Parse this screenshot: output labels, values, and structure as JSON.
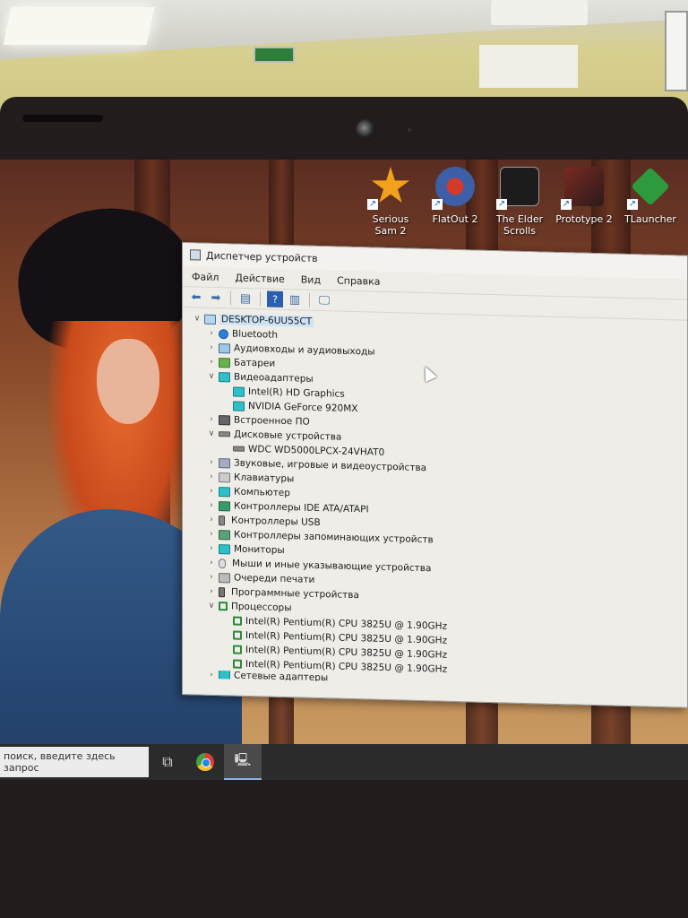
{
  "desktop": {
    "icons": [
      {
        "label": "Serious Sam 2",
        "color": "#f2a21a"
      },
      {
        "label": "FlatOut 2",
        "color": "#3c5fa8"
      },
      {
        "label": "The Elder Scrolls",
        "color": "#1c1c1c"
      },
      {
        "label": "Prototype 2",
        "color": "#7a2a22"
      },
      {
        "label": "TLauncher",
        "color": "#2e9a3e"
      }
    ]
  },
  "window": {
    "title": "Диспетчер устройств",
    "menu": [
      "Файл",
      "Действие",
      "Вид",
      "Справка"
    ],
    "toolbar": [
      "back-icon",
      "forward-icon",
      "properties-icon",
      "help-icon",
      "view-icon",
      "monitor-icon"
    ],
    "tree": {
      "root": "DESKTOP-6UU55CT",
      "items": [
        {
          "label": "Bluetooth",
          "expanded": false,
          "icon": "bluetooth-icon"
        },
        {
          "label": "Аудиовходы и аудиовыходы",
          "expanded": false,
          "icon": "audio-icon"
        },
        {
          "label": "Батареи",
          "expanded": false,
          "icon": "battery-icon"
        },
        {
          "label": "Видеоадаптеры",
          "expanded": true,
          "icon": "display-adapter-icon",
          "children": [
            "Intel(R) HD Graphics",
            "NVIDIA GeForce 920MX"
          ]
        },
        {
          "label": "Встроенное ПО",
          "expanded": false,
          "icon": "firmware-icon"
        },
        {
          "label": "Дисковые устройства",
          "expanded": true,
          "icon": "disk-icon",
          "children": [
            "WDC WD5000LPCX-24VHAT0"
          ]
        },
        {
          "label": "Звуковые, игровые и видеоустройства",
          "expanded": false,
          "icon": "sound-icon"
        },
        {
          "label": "Клавиатуры",
          "expanded": false,
          "icon": "keyboard-icon"
        },
        {
          "label": "Компьютер",
          "expanded": false,
          "icon": "computer-icon"
        },
        {
          "label": "Контроллеры IDE ATA/ATAPI",
          "expanded": false,
          "icon": "ide-icon"
        },
        {
          "label": "Контроллеры USB",
          "expanded": false,
          "icon": "usb-icon"
        },
        {
          "label": "Контроллеры запоминающих устройств",
          "expanded": false,
          "icon": "storage-icon"
        },
        {
          "label": "Мониторы",
          "expanded": false,
          "icon": "monitor-icon"
        },
        {
          "label": "Мыши и иные указывающие устройства",
          "expanded": false,
          "icon": "mouse-icon"
        },
        {
          "label": "Очереди печати",
          "expanded": false,
          "icon": "printer-icon"
        },
        {
          "label": "Программные устройства",
          "expanded": false,
          "icon": "software-device-icon"
        },
        {
          "label": "Процессоры",
          "expanded": true,
          "icon": "processor-icon",
          "children": [
            "Intel(R) Pentium(R) CPU 3825U @ 1.90GHz",
            "Intel(R) Pentium(R) CPU 3825U @ 1.90GHz",
            "Intel(R) Pentium(R) CPU 3825U @ 1.90GHz",
            "Intel(R) Pentium(R) CPU 3825U @ 1.90GHz"
          ]
        },
        {
          "label": "Сетевые адаптеры",
          "expanded": false,
          "icon": "network-icon"
        }
      ]
    }
  },
  "taskbar": {
    "search_placeholder": "поиск, введите здесь запрос"
  }
}
